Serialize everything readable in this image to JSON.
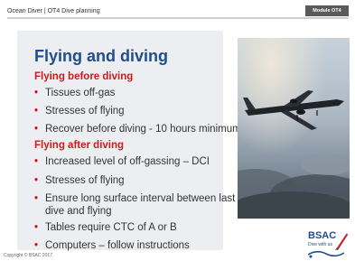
{
  "header": {
    "text": "Ocean Diver | OT4 Dive planning",
    "module_tab": "Module OT4"
  },
  "slide": {
    "title": "Flying and diving",
    "sections": [
      {
        "heading": "Flying before diving",
        "bullets": [
          "Tissues off-gas",
          "Stresses of flying",
          "Recover before diving - 10 hours minimum"
        ]
      },
      {
        "heading": "Flying after diving",
        "bullets": [
          "Increased level of off-gassing – DCI",
          "Stresses of flying",
          "Ensure long surface interval between last",
          "dive and flying",
          "Tables require CTC of A or B",
          "Computers – follow instructions"
        ]
      }
    ]
  },
  "footer": {
    "copyright": "Copyright © BSAC 2017"
  },
  "logo": {
    "name": "BSAC",
    "tagline": "Dive with us"
  },
  "icons": {
    "bullet": "•",
    "photo": "airplane-photo",
    "logo": "bsac-logo"
  },
  "colors": {
    "title": "#1f4e8c",
    "subheading": "#d11a1a",
    "bullet": "#d11a1a",
    "panel": "#eceef1"
  }
}
